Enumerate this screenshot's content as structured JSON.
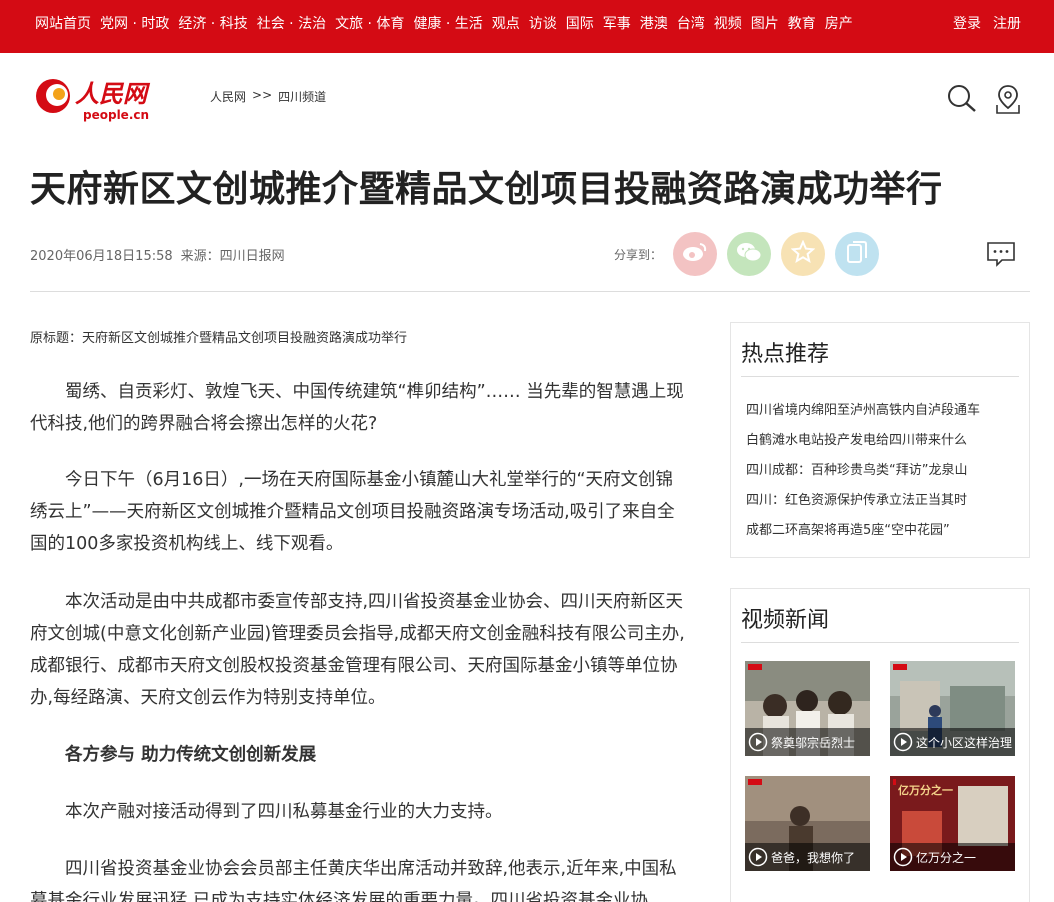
{
  "nav": {
    "items": [
      "网站首页",
      "党网 · 时政",
      "经济 · 科技",
      "社会 · 法治",
      "文旅 · 体育",
      "健康 · 生活",
      "观点",
      "访谈",
      "国际",
      "军事",
      "港澳",
      "台湾",
      "视频",
      "图片",
      "教育",
      "房产"
    ],
    "login": "登录",
    "register": "注册"
  },
  "header": {
    "logo_text": "人民网",
    "logo_sub": "people.cn",
    "breadcrumb": {
      "home": "人民网",
      "sep": ">>",
      "channel": "四川频道"
    }
  },
  "article": {
    "title": "天府新区文创城推介暨精品文创项目投融资路演成功举行",
    "date": "2020年06月18日15:58",
    "source": "来源：四川日报网",
    "share_label": "分享到：",
    "original_title": "原标题：天府新区文创城推介暨精品文创项目投融资路演成功举行",
    "paragraphs": [
      "蜀绣、自贡彩灯、敦煌飞天、中国传统建筑“榫卯结构”…… 当先辈的智慧遇上现代科技,他们的跨界融合将会擦出怎样的火花?",
      "今日下午（6月16日）,一场在天府国际基金小镇麓山大礼堂举行的“天府文创锦绣云上”——天府新区文创城推介暨精品文创项目投融资路演专场活动,吸引了来自全国的100多家投资机构线上、线下观看。",
      "本次活动是由中共成都市委宣传部支持,四川省投资基金业协会、四川天府新区天府文创城(中意文化创新产业园)管理委员会指导,成都天府文创金融科技有限公司主办,成都银行、成都市天府文创股权投资基金管理有限公司、天府国际基金小镇等单位协办,每经路演、天府文创云作为特别支持单位。",
      "各方参与 助力传统文创创新发展",
      "本次产融对接活动得到了四川私募基金行业的大力支持。",
      "四川省投资基金业协会会员部主任黄庆华出席活动并致辞,他表示,近年来,中国私募基金行业发展迅猛,已成为支持实体经济发展的重要力量。四川省投资基金业协"
    ]
  },
  "sidebar": {
    "hot_title": "热点推荐",
    "hot_items": [
      "四川省境内绵阳至泸州高铁内自泸段通车",
      "白鹤滩水电站投产发电给四川带来什么",
      "四川成都：百种珍贵鸟类“拜访”龙泉山",
      "四川：红色资源保护传承立法正当其时",
      "成都二环高架将再造5座“空中花园”"
    ],
    "video_title": "视频新闻",
    "videos": [
      "祭奠邬宗岳烈士",
      "这个小区这样治理",
      "爸爸，我想你了",
      "亿万分之一"
    ],
    "video_thumb_text": "亿万分之一"
  },
  "colors": {
    "brand_red": "#d40b14",
    "weibo": "#f3c3c3",
    "wechat": "#c4e5bc",
    "favorite": "#f7e2b4",
    "copy": "#bfe2f0"
  }
}
